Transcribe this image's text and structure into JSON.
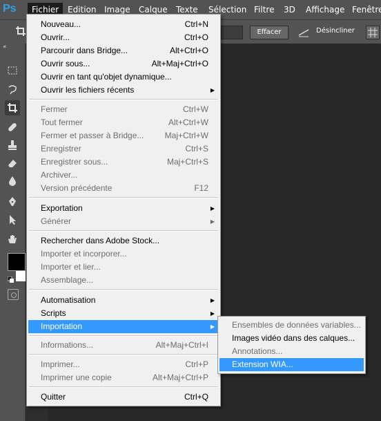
{
  "app": {
    "logo": "Ps"
  },
  "menubar": {
    "items": [
      "Fichier",
      "Edition",
      "Image",
      "Calque",
      "Texte",
      "Sélection",
      "Filtre",
      "3D",
      "Affichage",
      "Fenêtre"
    ],
    "active": "Fichier"
  },
  "options_bar": {
    "effacer_label": "Effacer",
    "desincliner_label": "Désincliner"
  },
  "file_menu": {
    "items": [
      {
        "label": "Nouveau...",
        "shortcut": "Ctrl+N"
      },
      {
        "label": "Ouvrir...",
        "shortcut": "Ctrl+O"
      },
      {
        "label": "Parcourir dans Bridge...",
        "shortcut": "Alt+Ctrl+O"
      },
      {
        "label": "Ouvrir sous...",
        "shortcut": "Alt+Maj+Ctrl+O"
      },
      {
        "label": "Ouvrir en tant qu'objet dynamique...",
        "shortcut": ""
      },
      {
        "label": "Ouvrir les fichiers récents",
        "shortcut": ""
      },
      {
        "label": "Fermer",
        "shortcut": "Ctrl+W"
      },
      {
        "label": "Tout fermer",
        "shortcut": "Alt+Ctrl+W"
      },
      {
        "label": "Fermer et passer à Bridge...",
        "shortcut": "Maj+Ctrl+W"
      },
      {
        "label": "Enregistrer",
        "shortcut": "Ctrl+S"
      },
      {
        "label": "Enregistrer sous...",
        "shortcut": "Maj+Ctrl+S"
      },
      {
        "label": "Archiver...",
        "shortcut": ""
      },
      {
        "label": "Version précédente",
        "shortcut": "F12"
      },
      {
        "label": "Exportation",
        "shortcut": ""
      },
      {
        "label": "Générer",
        "shortcut": ""
      },
      {
        "label": "Rechercher dans Adobe Stock...",
        "shortcut": ""
      },
      {
        "label": "Importer et incorporer...",
        "shortcut": ""
      },
      {
        "label": "Importer et lier...",
        "shortcut": ""
      },
      {
        "label": "Assemblage...",
        "shortcut": ""
      },
      {
        "label": "Automatisation",
        "shortcut": ""
      },
      {
        "label": "Scripts",
        "shortcut": ""
      },
      {
        "label": "Importation",
        "shortcut": ""
      },
      {
        "label": "Informations...",
        "shortcut": "Alt+Maj+Ctrl+I"
      },
      {
        "label": "Imprimer...",
        "shortcut": "Ctrl+P"
      },
      {
        "label": "Imprimer une copie",
        "shortcut": "Alt+Maj+Ctrl+P"
      },
      {
        "label": "Quitter",
        "shortcut": "Ctrl+Q"
      }
    ]
  },
  "import_submenu": {
    "items": [
      {
        "label": "Ensembles de données variables..."
      },
      {
        "label": "Images vidéo dans des calques..."
      },
      {
        "label": "Annotations..."
      },
      {
        "label": "Extension WIA..."
      }
    ]
  },
  "colors": {
    "highlight": "#3399ff",
    "disabled_text": "#6d6d6d",
    "menu_bg": "#f0f0f0",
    "ui_gray": "#535353"
  }
}
